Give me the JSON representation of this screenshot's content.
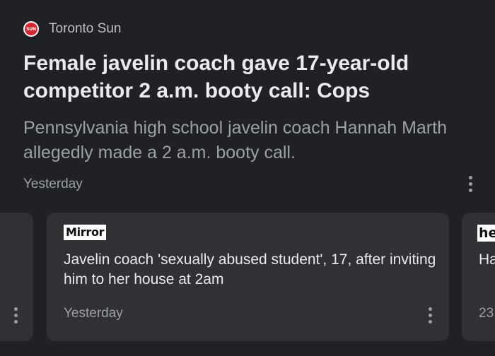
{
  "main_story": {
    "source": {
      "name": "Toronto Sun",
      "logo_text": "SUN",
      "logo_color": "#d9232d"
    },
    "headline": "Female javelin coach gave 17-year-old competitor 2 a.m. booty call: Cops",
    "snippet": "Pennsylvania high school javelin coach Hannah Marth allegedly made a 2 a.m. booty call.",
    "timestamp": "Yesterday",
    "more_icon": "more-vert-icon"
  },
  "related_stories": [
    {
      "source": "",
      "headline": "",
      "timestamp": "",
      "more_icon": "more-vert-icon"
    },
    {
      "source": "Mirror",
      "headline": "Javelin coach 'sexually abused student', 17, after inviting him to her house at 2am",
      "timestamp": "Yesterday",
      "more_icon": "more-vert-icon"
    },
    {
      "source": "he",
      "headline": "Ha",
      "timestamp": "23"
    }
  ],
  "colors": {
    "background": "#202124",
    "card": "#303134",
    "headline_text": "#e8eaed",
    "secondary_text": "#9aa0a6"
  }
}
